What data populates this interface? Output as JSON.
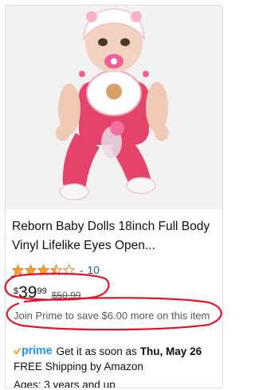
{
  "product": {
    "title": "Reborn Baby Dolls 18inch Full Body Vinyl Lifelike Eyes Open...",
    "rating": 3.5,
    "review_count": "10",
    "price_symbol": "$",
    "price_whole": "39",
    "price_fraction": "99",
    "list_price": "$50.99",
    "prime_save": "Join Prime to save $6.00 more on this item",
    "prime_label": "prime",
    "delivery_text": "Get it as soon as",
    "delivery_date": "Thu, May 26",
    "shipping": "FREE Shipping by Amazon",
    "ages": "Ages: 3 years and up"
  },
  "icons": {
    "check": "check-icon",
    "star": "star-icon",
    "chevron": "chevron-down-icon"
  },
  "colors": {
    "star": "#ffa41c",
    "link": "#007185",
    "prime": "#1a98ff",
    "annotation": "#e8112d",
    "doll_pink": "#e8456b"
  }
}
